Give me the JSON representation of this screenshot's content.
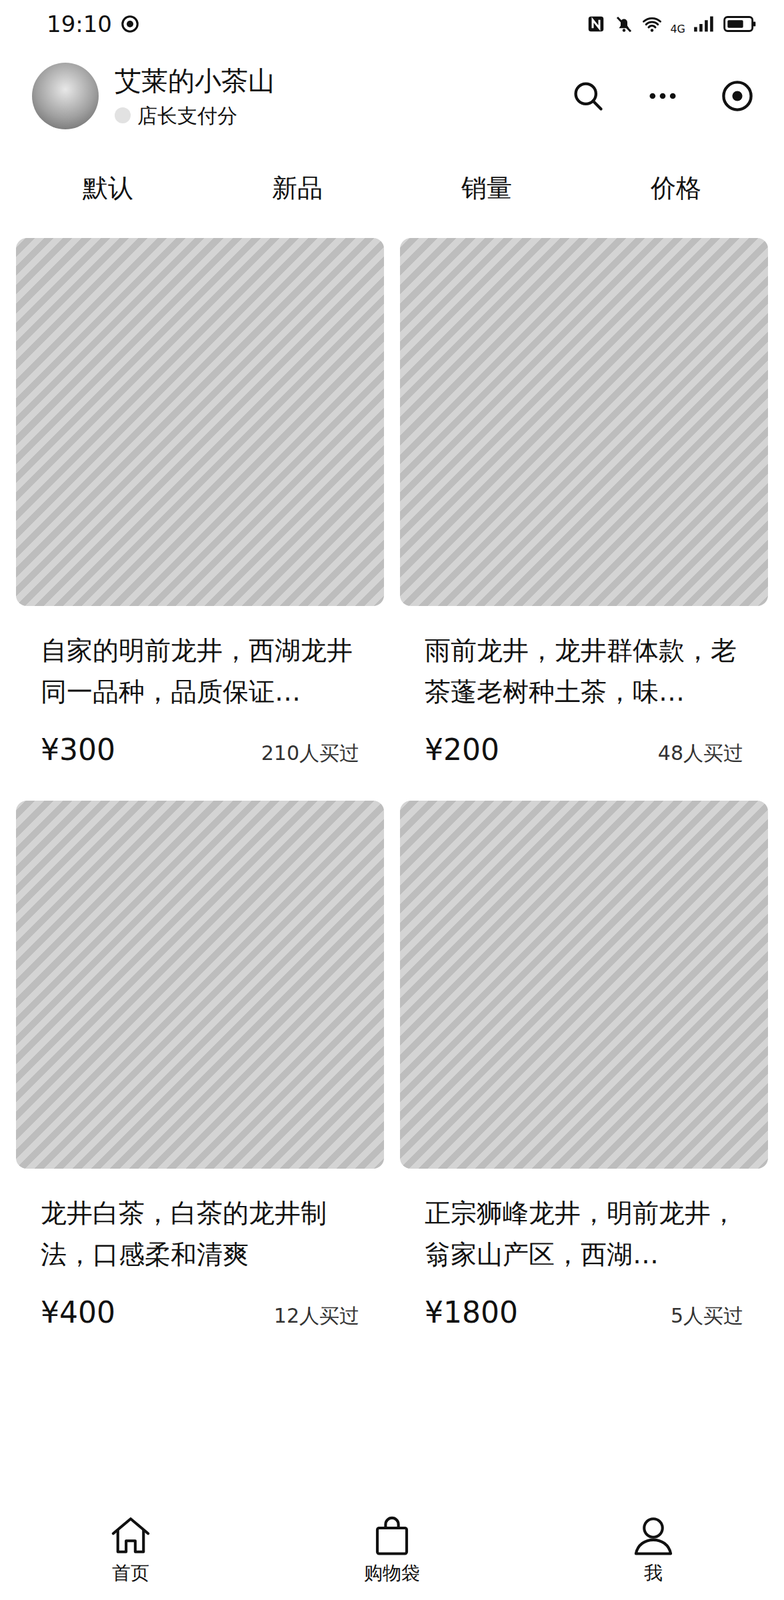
{
  "status": {
    "time": "19:10",
    "network": "4G"
  },
  "shop": {
    "name": "艾莱的小茶山",
    "subtitle": "店长支付分"
  },
  "sort_tabs": [
    {
      "label": "默认",
      "selected": false
    },
    {
      "label": "新品",
      "selected": false
    },
    {
      "label": "销量",
      "selected": false
    },
    {
      "label": "价格",
      "selected": false
    }
  ],
  "products": [
    {
      "title": "自家的明前龙井，西湖龙井同一品种，品质保证…",
      "price": "¥300",
      "sold": "210人买过"
    },
    {
      "title": "雨前龙井，龙井群体款，老茶蓬老树种土茶，味…",
      "price": "¥200",
      "sold": "48人买过"
    },
    {
      "title": "龙井白茶，白茶的龙井制法，口感柔和清爽",
      "price": "¥400",
      "sold": "12人买过"
    },
    {
      "title": "正宗狮峰龙井，明前龙井，翁家山产区，西湖…",
      "price": "¥1800",
      "sold": "5人买过"
    }
  ],
  "nav": [
    {
      "label": "首页",
      "kind": "home",
      "selected": false
    },
    {
      "label": "购物袋",
      "kind": "bag",
      "selected": false
    },
    {
      "label": "我",
      "kind": "user",
      "selected": false
    }
  ]
}
